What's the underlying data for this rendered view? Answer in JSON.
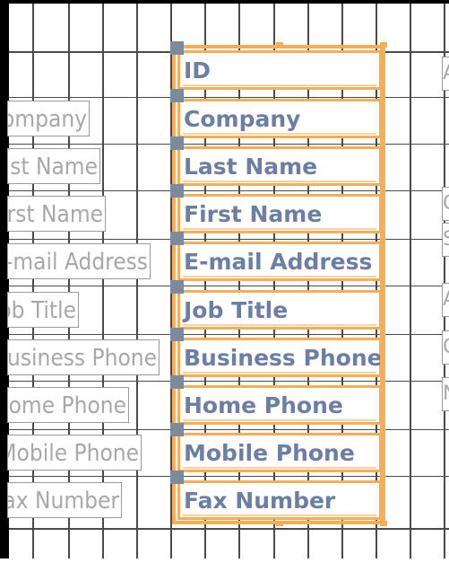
{
  "form_fields": [
    {
      "name": "field-id",
      "label": "",
      "field": "ID"
    },
    {
      "name": "field-company",
      "label": "Company",
      "field": "Company"
    },
    {
      "name": "field-last-name",
      "label": "Last Name",
      "field": "Last Name"
    },
    {
      "name": "field-first-name",
      "label": "First Name",
      "field": "First Name"
    },
    {
      "name": "field-email-address",
      "label": "E-mail Address",
      "field": "E-mail Address"
    },
    {
      "name": "field-job-title",
      "label": "Job Title",
      "field": "Job Title"
    },
    {
      "name": "field-business-phone",
      "label": "Business Phone",
      "field": "Business Phone"
    },
    {
      "name": "field-home-phone",
      "label": "Home Phone",
      "field": "Home Phone"
    },
    {
      "name": "field-mobile-phone",
      "label": "Mobile Phone",
      "field": "Mobile Phone"
    },
    {
      "name": "field-fax-number",
      "label": "Fax Number",
      "field": "Fax Number"
    }
  ],
  "right_column_labels": [
    "A",
    "C",
    "S",
    "A",
    "C",
    "N"
  ],
  "colors": {
    "selection": "#f6ad55",
    "field_text": "#6b7fa6",
    "label_text": "#a8a8a8",
    "grid": "#4a4a4a",
    "handle": "#7b8a9c"
  }
}
